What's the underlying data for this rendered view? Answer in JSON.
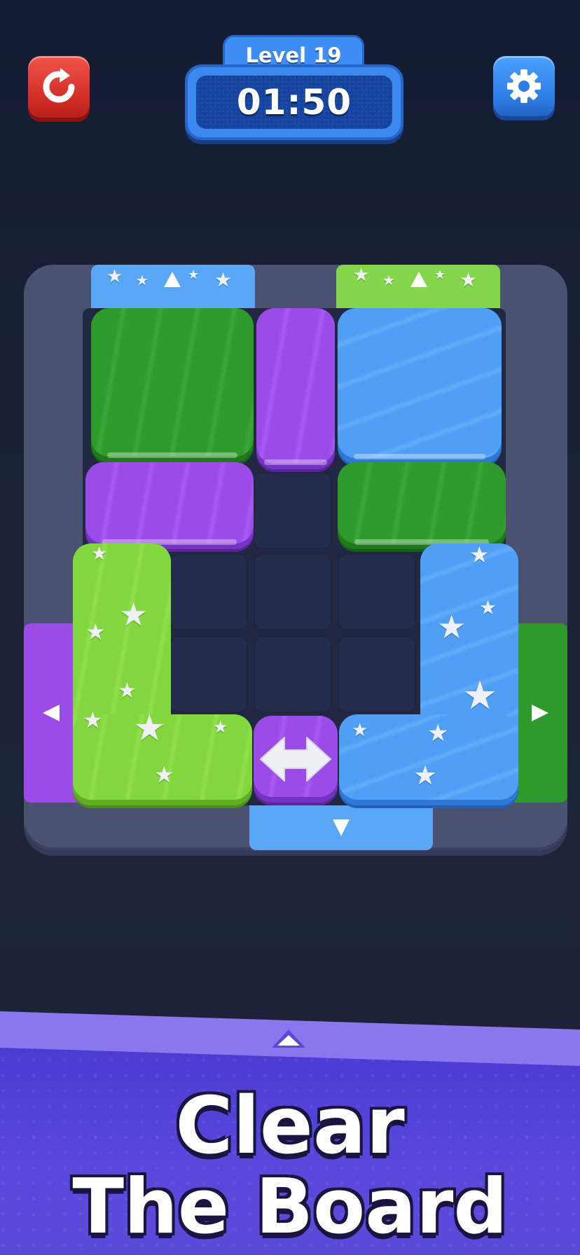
{
  "hud": {
    "level_label": "Level 19",
    "timer": "01:50",
    "restart_icon": "restart-arrow-icon",
    "settings_icon": "gear-icon"
  },
  "board": {
    "cols": 4,
    "rows": 6,
    "exits": [
      {
        "side": "top",
        "color": "blue",
        "arrow": "up"
      },
      {
        "side": "top",
        "color": "green",
        "arrow": "up"
      },
      {
        "side": "left",
        "color": "purple",
        "arrow": "left"
      },
      {
        "side": "right",
        "color": "dark-green",
        "arrow": "right"
      },
      {
        "side": "bottom",
        "color": "blue",
        "arrow": "down"
      }
    ],
    "blocks": [
      {
        "color": "dark-green",
        "shape": "2x2"
      },
      {
        "color": "purple",
        "shape": "1x2 vertical"
      },
      {
        "color": "blue",
        "shape": "2x2"
      },
      {
        "color": "purple",
        "shape": "2x1 horizontal"
      },
      {
        "color": "dark-green",
        "shape": "2x1 horizontal"
      },
      {
        "color": "lime",
        "shape": "L"
      },
      {
        "color": "purple",
        "shape": "1x1",
        "icon": "double-arrow-horizontal-icon"
      },
      {
        "color": "blue",
        "shape": "L"
      }
    ]
  },
  "banner": {
    "line1": "Clear",
    "line2": "The Board",
    "handle_icon": "chevron-up-icon"
  },
  "colors": {
    "dark_green": "#2f9a2c",
    "purple": "#9a4be8",
    "blue": "#4f9ff6",
    "lime": "#82d63e",
    "frame": "#4a5171",
    "banner": "#4a3bd2"
  }
}
